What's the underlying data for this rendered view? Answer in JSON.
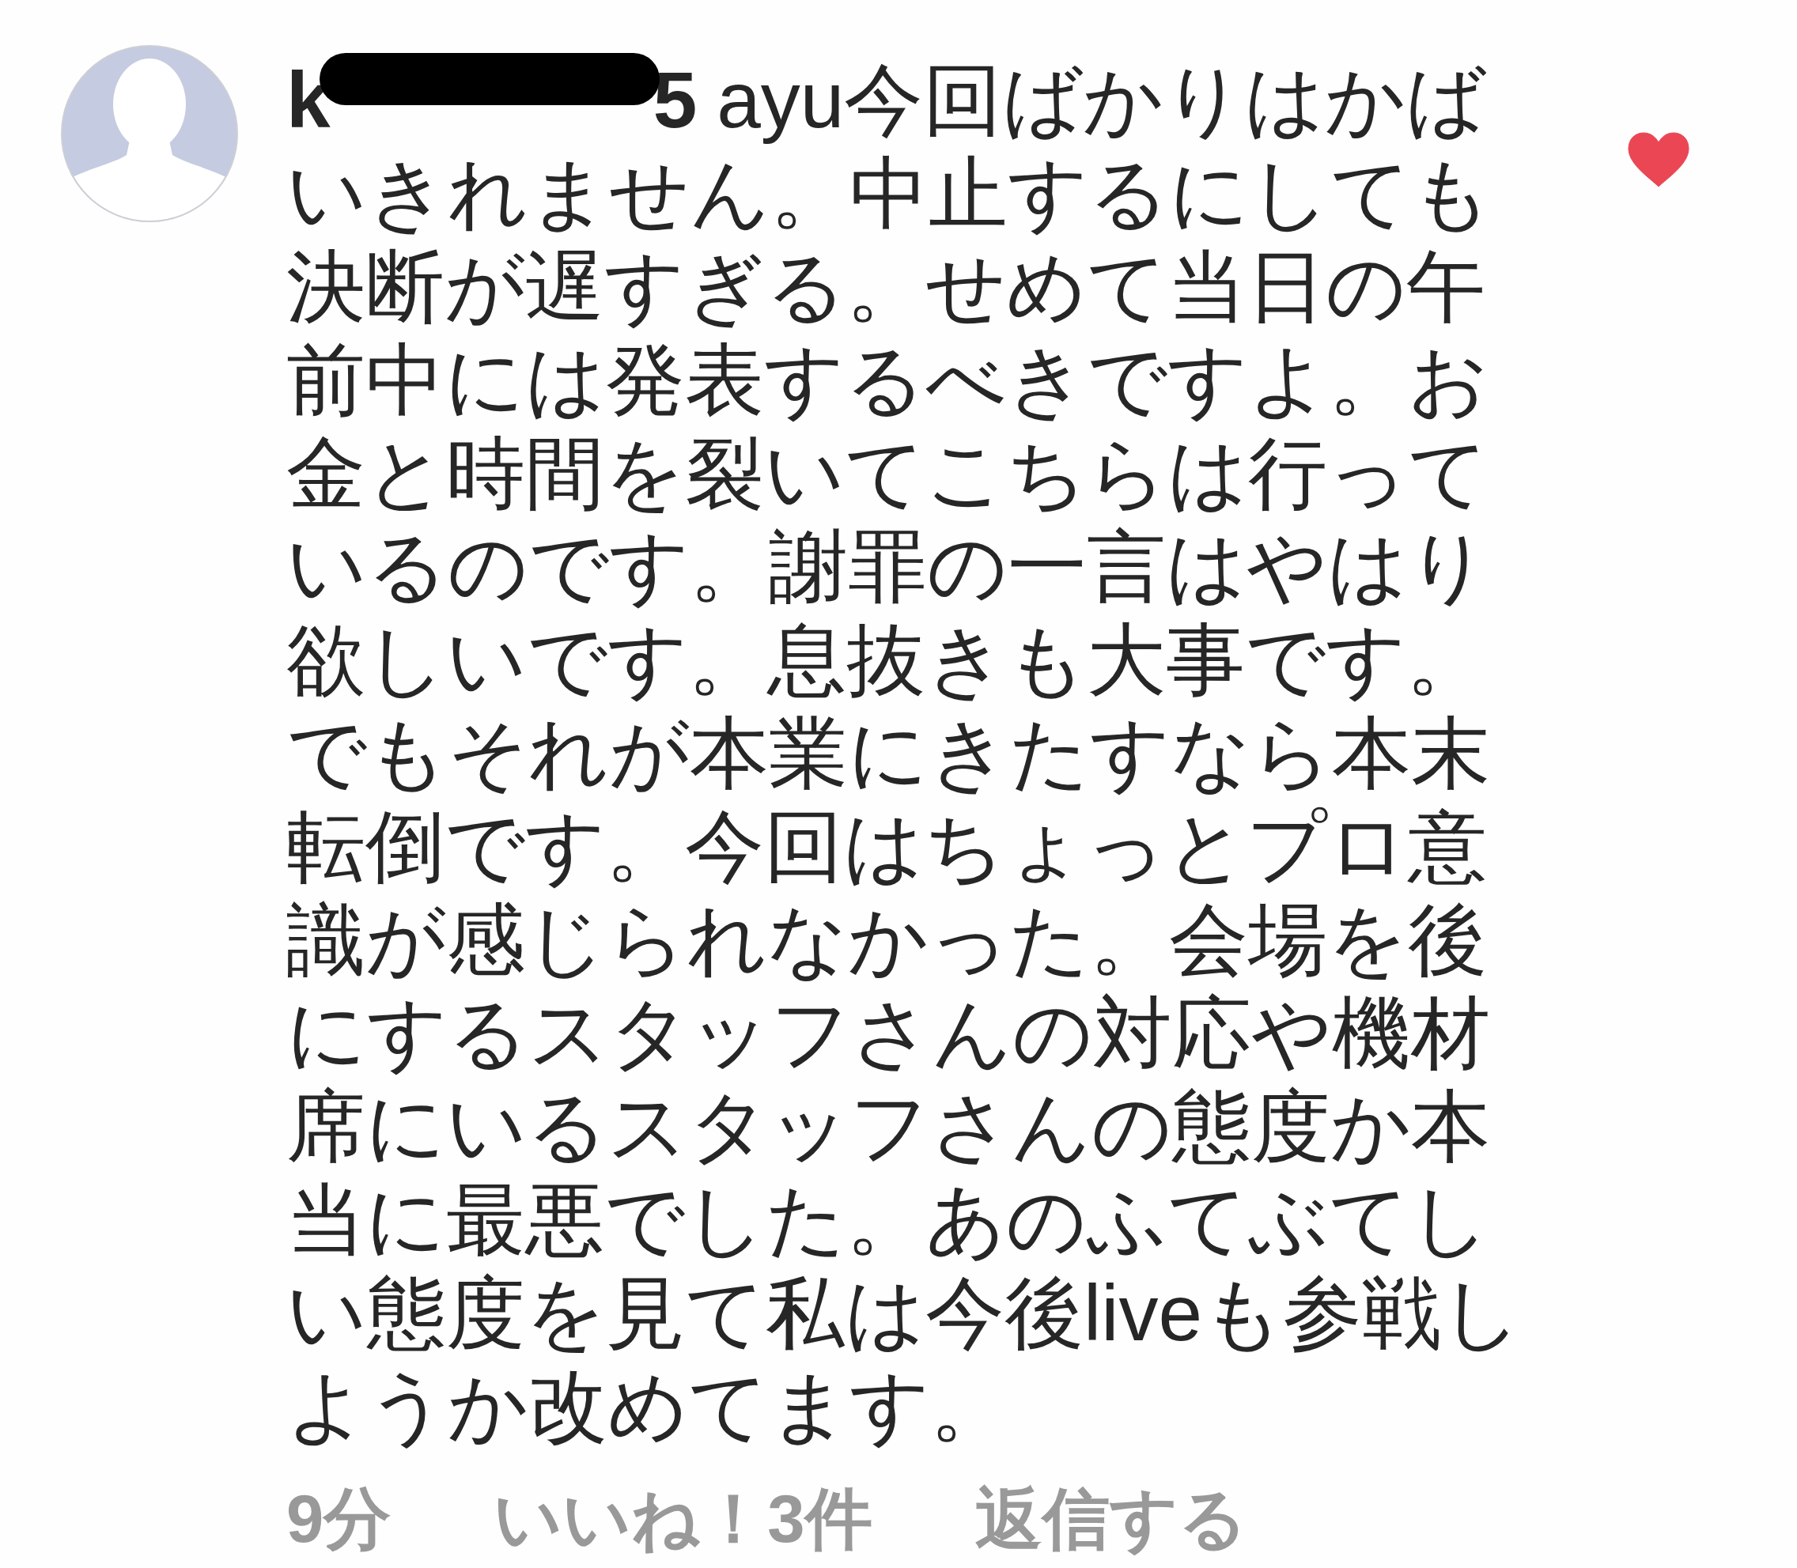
{
  "comment": {
    "author": {
      "visible_start": "k",
      "visible_end": "5",
      "redacted": true
    },
    "text": "ayu今回ばかりはかばいきれません。中止するにしても決断が遅すぎる。せめて当日の午前中には発表するべきですよ。お金と時間を裂いてこちらは行っているのです。謝罪の一言はやはり欲しいです。息抜きも大事です。でもそれが本業にきたすなら本末転倒です。今回はちょっとプロ意識が感じられなかった。会場を後にするスタッフさんの対応や機材席にいるスタッフさんの態度か本当に最悪でした。あのふてぶてしい態度を見て私は今後liveも参戦しようか改めてます。",
    "liked": true,
    "time": "9分",
    "likes": "いいね！3件",
    "reply": "返信する"
  }
}
